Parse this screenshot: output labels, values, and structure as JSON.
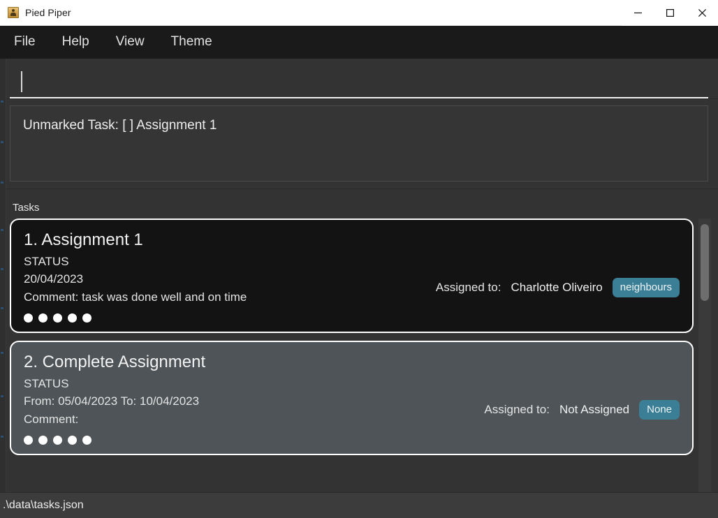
{
  "window": {
    "title": "Pied Piper",
    "icon": "person-badge-icon",
    "controls": {
      "minimize": "minimize-icon",
      "maximize": "maximize-icon",
      "close": "close-icon"
    }
  },
  "menubar": {
    "items": [
      {
        "label": "File"
      },
      {
        "label": "Help"
      },
      {
        "label": "View"
      },
      {
        "label": "Theme"
      }
    ]
  },
  "command_input": {
    "value": "",
    "placeholder": ""
  },
  "output": {
    "lines": [
      "Unmarked Task: [ ] Assignment 1"
    ],
    "text": "Unmarked Task: [ ] Assignment 1"
  },
  "tasks_section": {
    "label": "Tasks",
    "assigned_label": "Assigned to:",
    "tasks": [
      {
        "index": "1.",
        "title": "1. Assignment 1",
        "status": "STATUS",
        "date": "20/04/2023",
        "comment": "Comment: task was done well and on time",
        "assigned_label": "Assigned to:",
        "assignee": "Charlotte Oliveiro",
        "badge": "neighbours",
        "badge_color": "#3b7f96",
        "dots": 5,
        "theme": "dark"
      },
      {
        "index": "2.",
        "title": "2. Complete Assignment",
        "status": "STATUS",
        "date": "From: 05/04/2023 To: 10/04/2023",
        "comment": "Comment:",
        "assigned_label": "Assigned to:",
        "assignee": "Not Assigned",
        "badge": "None",
        "badge_color": "#3b7f96",
        "dots": 5,
        "theme": "light"
      }
    ]
  },
  "statusbar": {
    "path": ".\\data\\tasks.json"
  },
  "colors": {
    "window_bg": "#333333",
    "menubar_bg": "#1a1a1a",
    "titlebar_bg": "#ffffff",
    "card_dark": "#131313",
    "card_light": "#4e5457",
    "badge_teal": "#3b7f96",
    "statusbar_bg": "#3c3c3c",
    "accent_text": "#ededed"
  }
}
